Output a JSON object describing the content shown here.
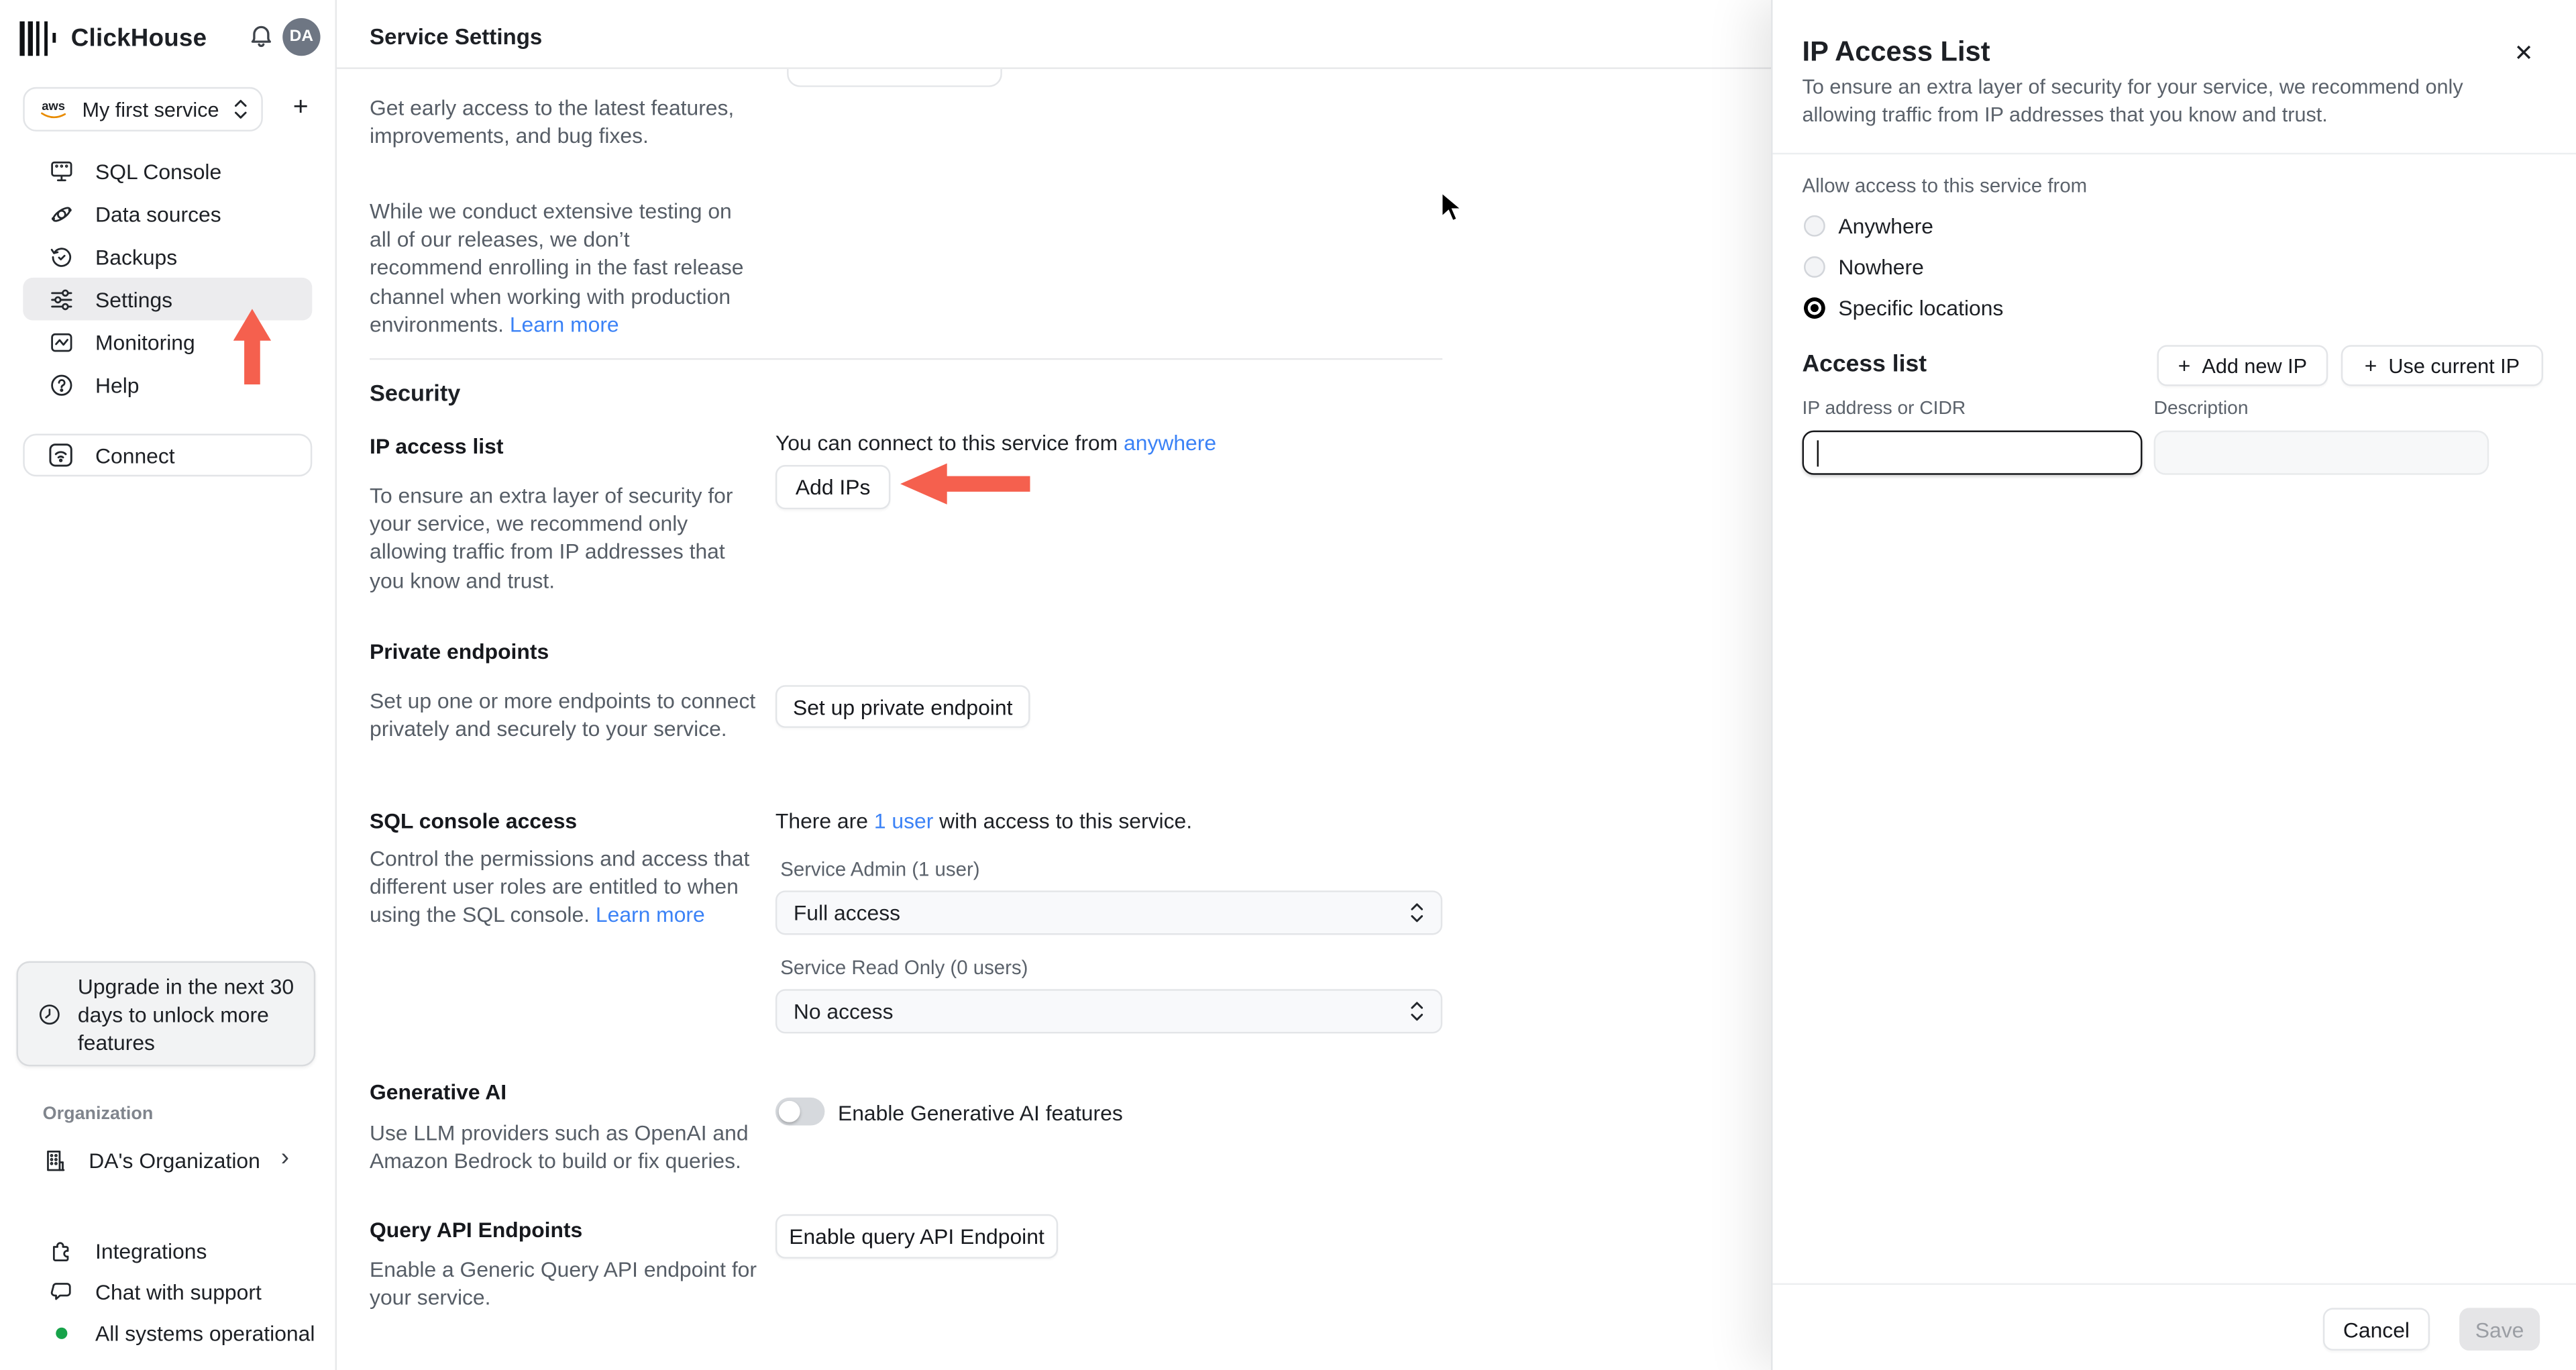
{
  "colors": {
    "accent_arrow_red": "#f5604e",
    "link_blue": "#3b82f6",
    "status_green": "#17a34a",
    "selected_nav_bg": "#ececee"
  },
  "icons": {
    "plus": "+",
    "close": "✕",
    "chevron_right": "›",
    "aws": "aws"
  },
  "sidebar": {
    "brand": "ClickHouse",
    "avatar_initials": "DA",
    "service_selector": {
      "label": "My first service"
    },
    "nav": [
      {
        "label": "SQL Console"
      },
      {
        "label": "Data sources"
      },
      {
        "label": "Backups"
      },
      {
        "label": "Settings"
      },
      {
        "label": "Monitoring"
      },
      {
        "label": "Help"
      }
    ],
    "connect_label": "Connect",
    "upgrade_text": "Upgrade in the next 30 days to unlock more features",
    "organization_label": "Organization",
    "organization_name": "DA's Organization",
    "footer": {
      "integrations": "Integrations",
      "chat": "Chat with support",
      "status": "All systems operational"
    }
  },
  "main": {
    "title": "Service Settings",
    "fast_release": {
      "p1": "Get early access to the latest features, improvements, and bug fixes.",
      "p2": "While we conduct extensive testing on all of our releases, we don’t recommend enrolling in the fast release channel when working with production environments. ",
      "p2_link": "Learn more"
    },
    "security_title": "Security",
    "ip_access_list": {
      "title": "IP access list",
      "desc": "To ensure an extra layer of security for your service, we recommend only allowing traffic from IP addresses that you know and trust.",
      "connect_prefix": "You can connect to this service from ",
      "connect_link": "anywhere",
      "add_ips_label": "Add IPs"
    },
    "private_endpoints": {
      "title": "Private endpoints",
      "desc": "Set up one or more endpoints to connect privately and securely to your service.",
      "button_label": "Set up private endpoint"
    },
    "sql_console_access": {
      "title": "SQL console access",
      "users_prefix": "There are ",
      "users_link": "1 user",
      "users_suffix": " with access to this service.",
      "desc": "Control the permissions and access that different user roles are entitled to when using the SQL console. ",
      "desc_link": "Learn more",
      "admin_label": "Service Admin (1 user)",
      "admin_value": "Full access",
      "readonly_label": "Service Read Only (0 users)",
      "readonly_value": "No access"
    },
    "generative_ai": {
      "title": "Generative AI",
      "toggle_label": "Enable Generative AI features",
      "desc": "Use LLM providers such as OpenAI and Amazon Bedrock to build or fix queries."
    },
    "query_api": {
      "title": "Query API Endpoints",
      "button_label": "Enable query API Endpoint",
      "desc": "Enable a Generic Query API endpoint for your service."
    }
  },
  "panel": {
    "title": "IP Access List",
    "desc": "To ensure an extra layer of security for your service, we recommend only allowing traffic from IP addresses that you know and trust.",
    "allow_label": "Allow access to this service from",
    "radios": [
      {
        "label": "Anywhere",
        "selected": false
      },
      {
        "label": "Nowhere",
        "selected": false
      },
      {
        "label": "Specific locations",
        "selected": true
      }
    ],
    "access_list_title": "Access list",
    "add_new_ip_label": "Add new IP",
    "use_current_ip_label": "Use current IP",
    "ip_field_label": "IP address or CIDR",
    "ip_field_value": "",
    "description_field_label": "Description",
    "description_field_value": "",
    "cancel_label": "Cancel",
    "save_label": "Save"
  }
}
